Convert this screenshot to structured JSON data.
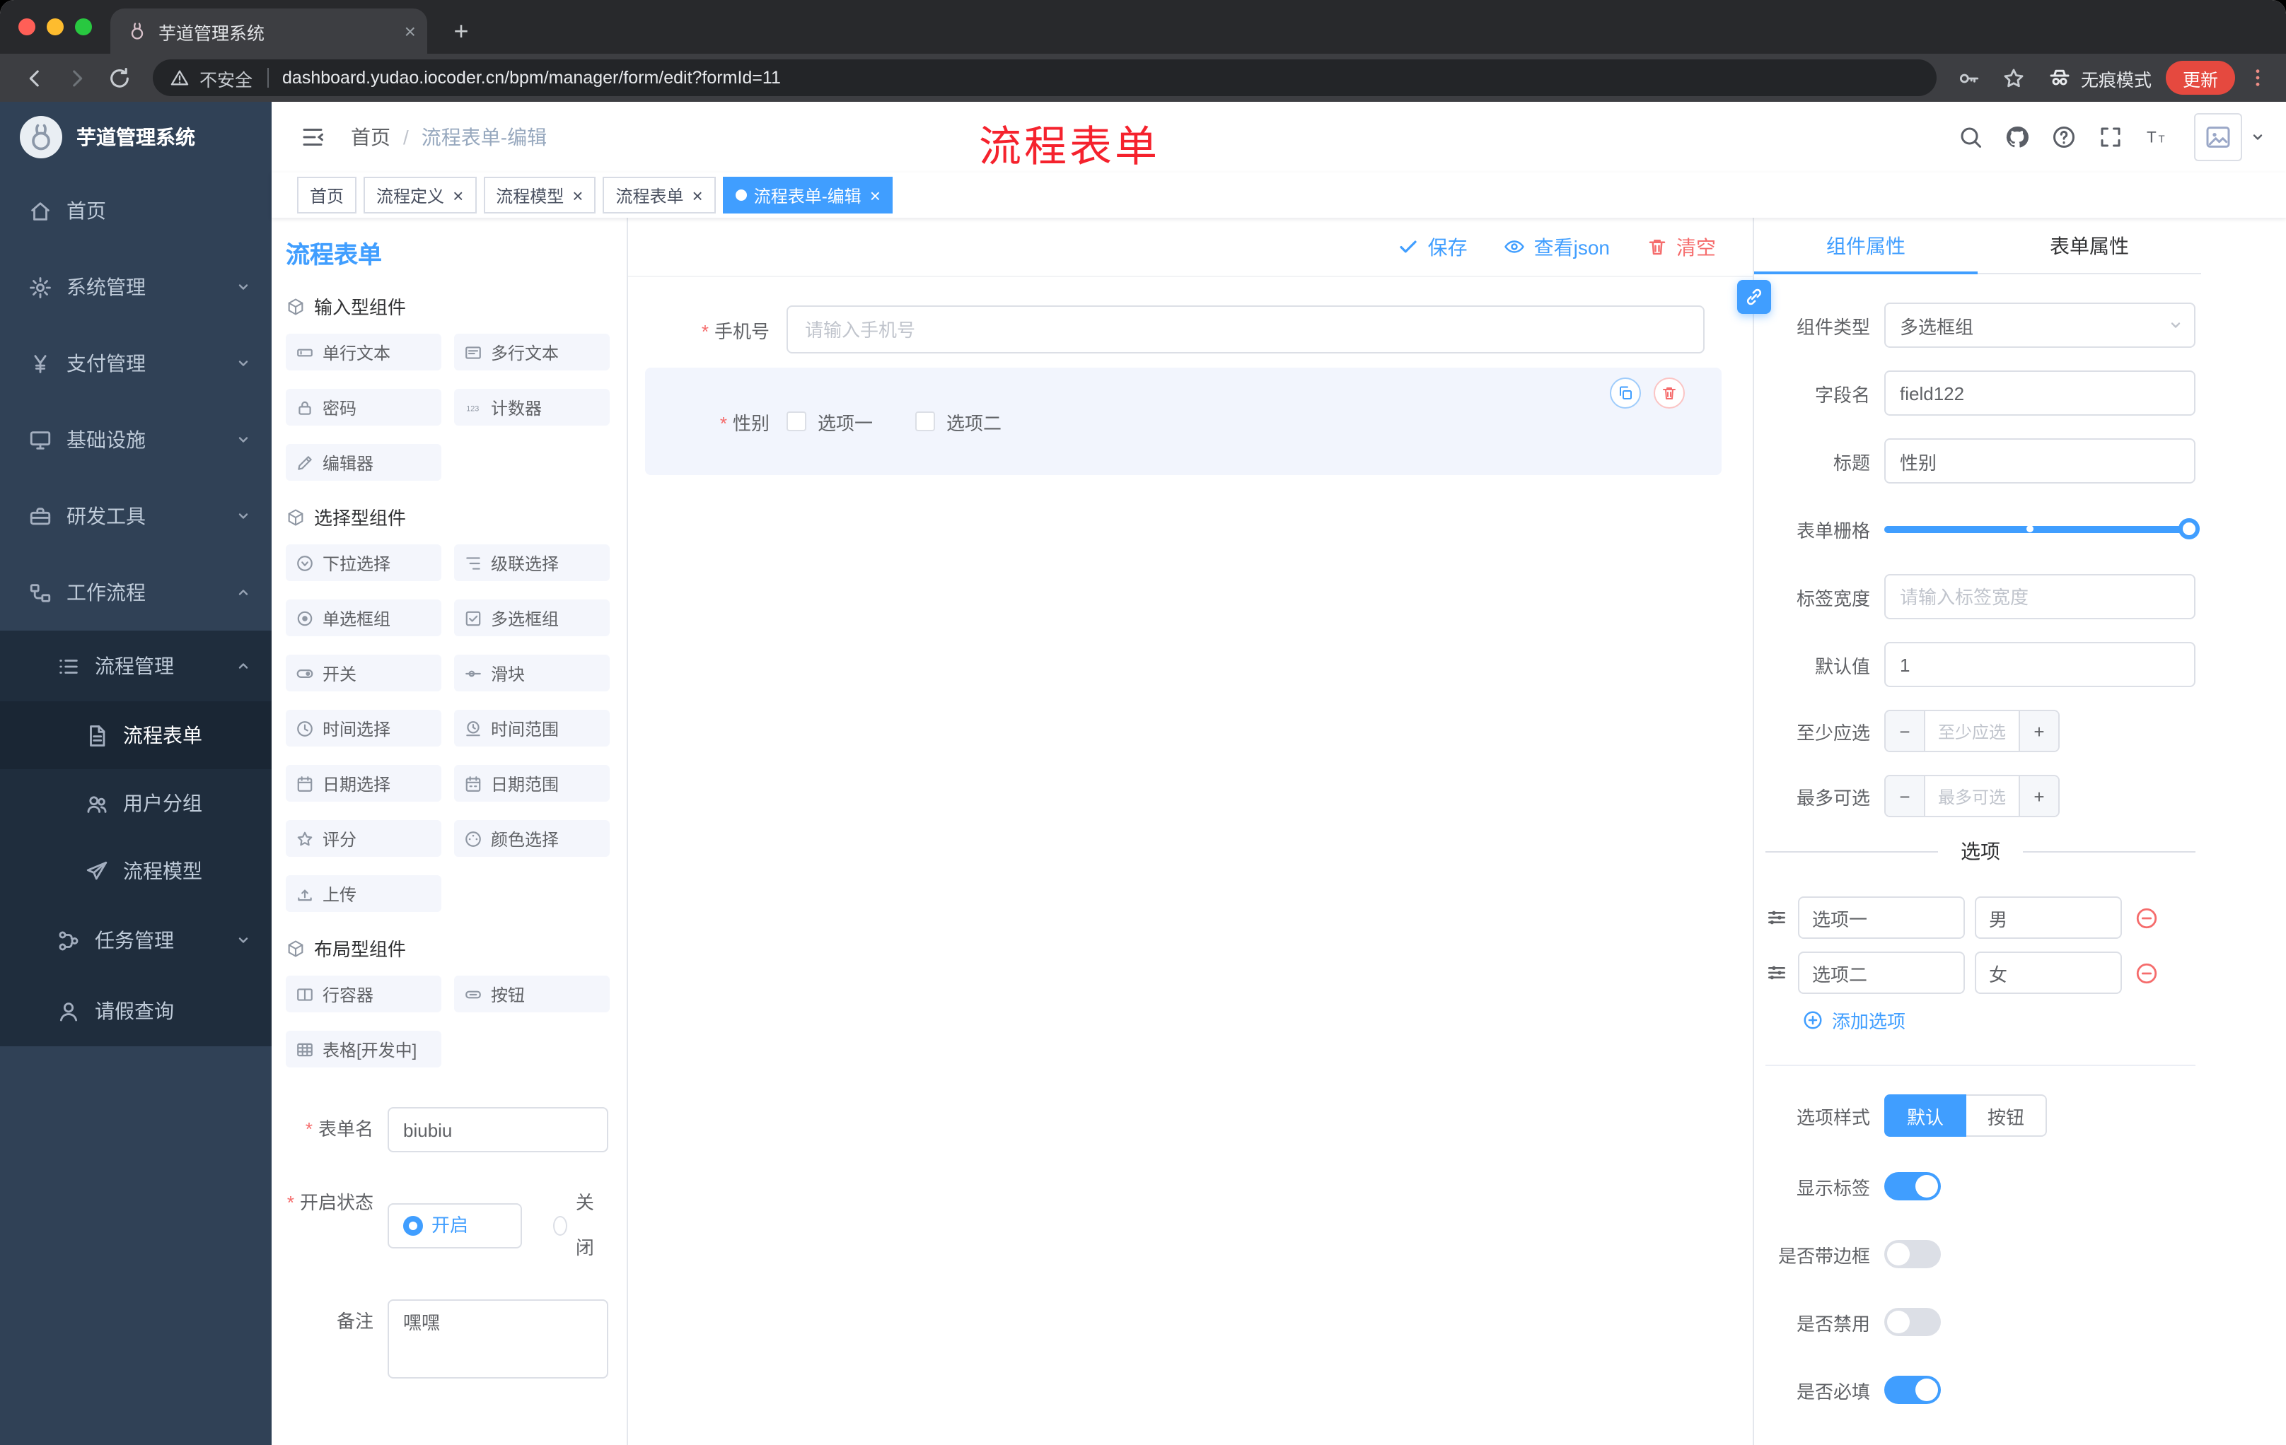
{
  "browser": {
    "tab_title": "芋道管理系统",
    "close_glyph": "×",
    "new_tab_glyph": "+",
    "security_label": "不安全",
    "url": "dashboard.yudao.iocoder.cn/bpm/manager/form/edit?formId=11",
    "incognito_label": "无痕模式",
    "update_label": "更新"
  },
  "sidebar": {
    "logo_title": "芋道管理系统",
    "items": [
      {
        "label": "首页",
        "icon": "home-icon"
      },
      {
        "label": "系统管理",
        "icon": "gear-icon",
        "state": "collapsed"
      },
      {
        "label": "支付管理",
        "icon": "yen-icon",
        "state": "collapsed"
      },
      {
        "label": "基础设施",
        "icon": "monitor-icon",
        "state": "collapsed"
      },
      {
        "label": "研发工具",
        "icon": "briefcase-icon",
        "state": "collapsed"
      },
      {
        "label": "工作流程",
        "icon": "workflow-icon",
        "state": "expanded"
      },
      {
        "label": "流程管理",
        "icon": "list-icon",
        "state": "expanded"
      },
      {
        "label": "流程表单",
        "icon": "document-icon",
        "active": true
      },
      {
        "label": "用户分组",
        "icon": "users-icon"
      },
      {
        "label": "流程模型",
        "icon": "send-icon"
      },
      {
        "label": "任务管理",
        "icon": "branch-icon",
        "state": "collapsed"
      },
      {
        "label": "请假查询",
        "icon": "person-icon"
      }
    ]
  },
  "header": {
    "breadcrumb": [
      "首页",
      "流程表单-编辑"
    ],
    "separator": "/",
    "annotation": "流程表单"
  },
  "tags": {
    "close_glyph": "×",
    "items": [
      {
        "label": "首页",
        "closable": false,
        "active": false
      },
      {
        "label": "流程定义",
        "closable": true,
        "active": false
      },
      {
        "label": "流程模型",
        "closable": true,
        "active": false
      },
      {
        "label": "流程表单",
        "closable": true,
        "active": false
      },
      {
        "label": "流程表单-编辑",
        "closable": true,
        "active": true
      }
    ]
  },
  "palette": {
    "title": "流程表单",
    "groups": [
      {
        "title": "输入型组件",
        "items": [
          {
            "label": "单行文本",
            "icon": "input-icon"
          },
          {
            "label": "多行文本",
            "icon": "textarea-icon"
          },
          {
            "label": "密码",
            "icon": "lock-icon"
          },
          {
            "label": "计数器",
            "icon": "counter-icon"
          },
          {
            "label": "编辑器",
            "icon": "editor-icon"
          }
        ]
      },
      {
        "title": "选择型组件",
        "items": [
          {
            "label": "下拉选择",
            "icon": "select-icon"
          },
          {
            "label": "级联选择",
            "icon": "cascader-icon"
          },
          {
            "label": "单选框组",
            "icon": "radio-icon"
          },
          {
            "label": "多选框组",
            "icon": "checkbox-icon"
          },
          {
            "label": "开关",
            "icon": "switch-icon"
          },
          {
            "label": "滑块",
            "icon": "slider-icon"
          },
          {
            "label": "时间选择",
            "icon": "time-icon"
          },
          {
            "label": "时间范围",
            "icon": "time-range-icon"
          },
          {
            "label": "日期选择",
            "icon": "date-icon"
          },
          {
            "label": "日期范围",
            "icon": "date-range-icon"
          },
          {
            "label": "评分",
            "icon": "rate-icon"
          },
          {
            "label": "颜色选择",
            "icon": "color-icon"
          },
          {
            "label": "上传",
            "icon": "upload-icon"
          }
        ]
      },
      {
        "title": "布局型组件",
        "items": [
          {
            "label": "行容器",
            "icon": "row-icon"
          },
          {
            "label": "按钮",
            "icon": "button-icon"
          },
          {
            "label": "表格[开发中]",
            "icon": "table-icon"
          }
        ]
      }
    ],
    "form": {
      "name_label": "表单名",
      "name_value": "biubiu",
      "status_label": "开启状态",
      "status_on": "开启",
      "status_off": "关闭",
      "remark_label": "备注",
      "remark_value": "嘿嘿"
    }
  },
  "toolbar": {
    "save": "保存",
    "view_json": "查看json",
    "clear": "清空"
  },
  "canvas": {
    "phone_label": "手机号",
    "phone_placeholder": "请输入手机号",
    "gender_label": "性别",
    "gender_options": [
      {
        "label": "选项一",
        "checked": false
      },
      {
        "label": "选项二",
        "checked": false
      }
    ]
  },
  "props": {
    "tab_component": "组件属性",
    "tab_form": "表单属性",
    "type_label": "组件类型",
    "type_value": "多选框组",
    "field_label": "字段名",
    "field_value": "field122",
    "title_label": "标题",
    "title_value": "性别",
    "grid_label": "表单栅格",
    "width_label": "标签宽度",
    "width_placeholder": "请输入标签宽度",
    "default_label": "默认值",
    "default_value": "1",
    "min_label": "至少应选",
    "min_placeholder": "至少应选",
    "max_label": "最多可选",
    "max_placeholder": "最多可选",
    "minus_glyph": "−",
    "plus_glyph": "+",
    "options_title": "选项",
    "options": [
      {
        "label": "选项一",
        "value": "男"
      },
      {
        "label": "选项二",
        "value": "女"
      }
    ],
    "add_option": "添加选项",
    "style_label": "选项样式",
    "style_default": "默认",
    "style_button": "按钮",
    "toggles": [
      {
        "label": "显示标签",
        "on": true
      },
      {
        "label": "是否带边框",
        "on": false
      },
      {
        "label": "是否禁用",
        "on": false
      },
      {
        "label": "是否必填",
        "on": true
      }
    ]
  },
  "colors": {
    "primary": "#409eff",
    "danger": "#f56c6c",
    "annotation_red": "#f5222d",
    "sidebar_bg": "#304156",
    "submenu_bg": "#1f2d3d",
    "update_red": "#e5493f"
  }
}
